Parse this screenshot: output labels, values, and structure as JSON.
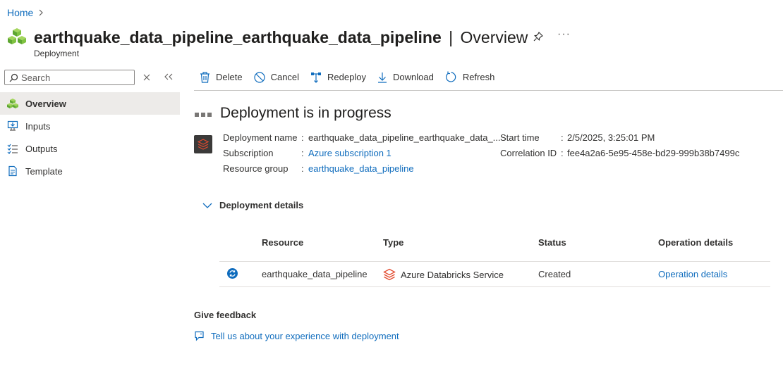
{
  "breadcrumb": {
    "home": "Home",
    "chevron": ">"
  },
  "header": {
    "resource_name": "earthquake_data_pipeline_earthquake_data_pipeline",
    "separator": "|",
    "section": "Overview",
    "subtitle": "Deployment",
    "more": "···"
  },
  "sidebar": {
    "search_placeholder": "Search",
    "items": [
      {
        "label": "Overview",
        "icon": "cubes-icon",
        "active": true
      },
      {
        "label": "Inputs",
        "icon": "inputs-icon"
      },
      {
        "label": "Outputs",
        "icon": "outputs-icon"
      },
      {
        "label": "Template",
        "icon": "template-icon"
      }
    ]
  },
  "toolbar": {
    "delete": "Delete",
    "cancel": "Cancel",
    "redeploy": "Redeploy",
    "download": "Download",
    "refresh": "Refresh"
  },
  "status": {
    "title": "Deployment is in progress"
  },
  "info": {
    "deployment_name_label": "Deployment name",
    "deployment_name_value": "earthquake_data_pipeline_earthquake_data_...",
    "subscription_label": "Subscription",
    "subscription_value": "Azure subscription 1",
    "resource_group_label": "Resource group",
    "resource_group_value": "earthquake_data_pipeline",
    "start_time_label": "Start time",
    "start_time_value": "2/5/2025, 3:25:01 PM",
    "correlation_label": "Correlation ID",
    "correlation_value": "fee4a2a6-5e95-458e-bd29-999b38b7499c",
    "colon": ":"
  },
  "details": {
    "toggle_label": "Deployment details",
    "columns": {
      "resource": "Resource",
      "type": "Type",
      "status": "Status",
      "operation": "Operation details"
    },
    "rows": [
      {
        "resource": "earthquake_data_pipeline",
        "type": "Azure Databricks Service",
        "status": "Created",
        "operation": "Operation details"
      }
    ]
  },
  "feedback": {
    "title": "Give feedback",
    "link": "Tell us about your experience with deployment"
  },
  "colors": {
    "accent": "#0f6cbd",
    "databricks": "#e34b2f",
    "sync_icon": "#0f6cbd"
  }
}
